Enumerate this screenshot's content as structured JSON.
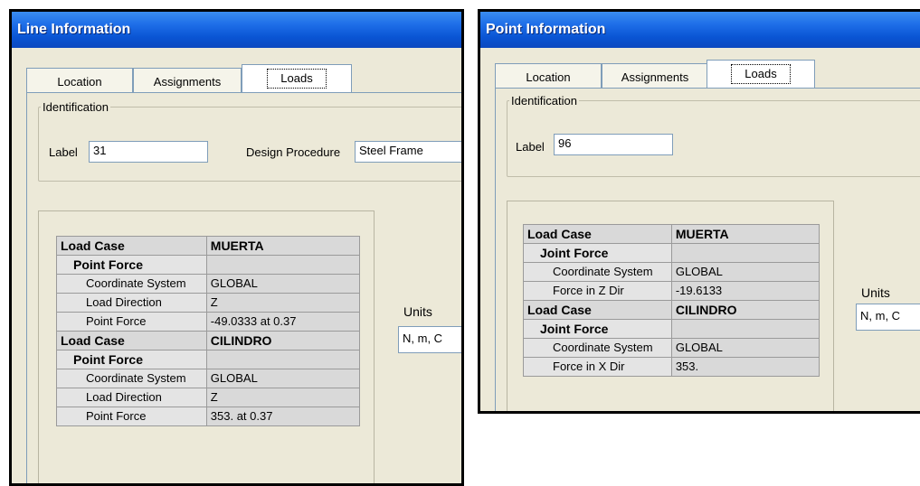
{
  "line_window": {
    "title": "Line Information",
    "tabs": [
      "Location",
      "Assignments",
      "Loads"
    ],
    "identification": {
      "legend": "Identification",
      "label_caption": "Label",
      "label_value": "31",
      "design_caption": "Design Procedure",
      "design_value": "Steel Frame"
    },
    "units": {
      "caption": "Units",
      "value": "N, m, C"
    },
    "rows": [
      {
        "name": "Load Case",
        "value": "MUERTA",
        "level": 0
      },
      {
        "name": "Point Force",
        "value": "",
        "level": 1
      },
      {
        "name": "Coordinate System",
        "value": "GLOBAL",
        "level": 2
      },
      {
        "name": "Load Direction",
        "value": "Z",
        "level": 2
      },
      {
        "name": "Point Force",
        "value": "-49.0333 at 0.37",
        "level": 2
      },
      {
        "name": "Load Case",
        "value": "CILINDRO",
        "level": 0
      },
      {
        "name": "Point Force",
        "value": "",
        "level": 1
      },
      {
        "name": "Coordinate System",
        "value": "GLOBAL",
        "level": 2
      },
      {
        "name": "Load Direction",
        "value": "Z",
        "level": 2
      },
      {
        "name": "Point Force",
        "value": "353. at 0.37",
        "level": 2
      }
    ]
  },
  "point_window": {
    "title": "Point Information",
    "tabs": [
      "Location",
      "Assignments",
      "Loads"
    ],
    "identification": {
      "legend": "Identification",
      "label_caption": "Label",
      "label_value": "96"
    },
    "units": {
      "caption": "Units",
      "value": "N, m, C"
    },
    "rows": [
      {
        "name": "Load Case",
        "value": "MUERTA",
        "level": 0
      },
      {
        "name": "Joint Force",
        "value": "",
        "level": 1
      },
      {
        "name": "Coordinate System",
        "value": "GLOBAL",
        "level": 2
      },
      {
        "name": "Force in Z Dir",
        "value": "-19.6133",
        "level": 2
      },
      {
        "name": "Load Case",
        "value": "CILINDRO",
        "level": 0
      },
      {
        "name": "Joint Force",
        "value": "",
        "level": 1
      },
      {
        "name": "Coordinate System",
        "value": "GLOBAL",
        "level": 2
      },
      {
        "name": "Force in X Dir",
        "value": "353.",
        "level": 2
      }
    ]
  }
}
